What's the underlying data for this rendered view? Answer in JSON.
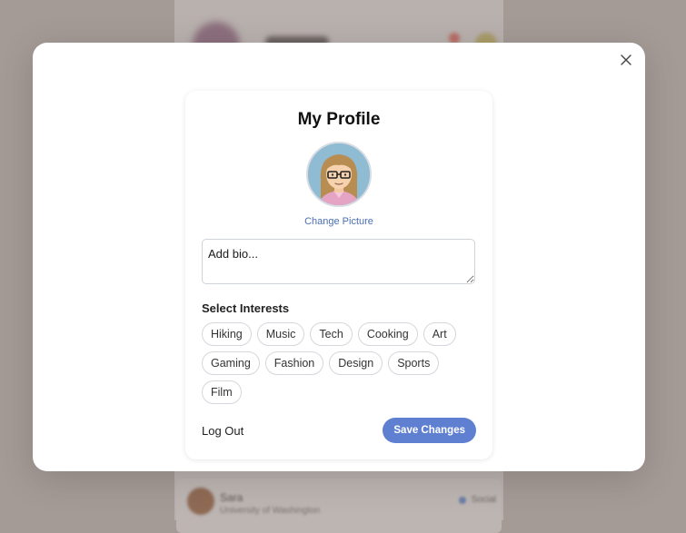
{
  "background": {
    "card_name": "Sara",
    "card_subtitle": "University of Washington",
    "card_tag": "Social"
  },
  "modal": {
    "close_icon": "close-icon"
  },
  "profile": {
    "title": "My Profile",
    "avatar_icon": "avatar-illustration",
    "change_picture": "Change Picture",
    "bio_placeholder": "Add bio...",
    "interests_label": "Select Interests",
    "interests": [
      "Hiking",
      "Music",
      "Tech",
      "Cooking",
      "Art",
      "Gaming",
      "Fashion",
      "Design",
      "Sports",
      "Film"
    ],
    "logout_label": "Log Out",
    "save_label": "Save Changes"
  },
  "colors": {
    "accent": "#5f7fd0",
    "link": "#4a6fb5"
  }
}
